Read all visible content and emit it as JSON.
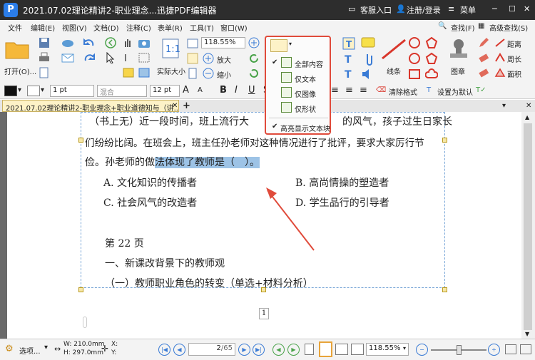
{
  "app": {
    "logo": "P",
    "title": "2021.07.02理论精讲2-职业理念...迅捷PDF编辑器",
    "service": "客服入口",
    "login": "注册/登录",
    "menu": "菜单"
  },
  "menu": {
    "file": "文件",
    "edit": "编辑(E)",
    "view": "视图(V)",
    "doc": "文档(D)",
    "comment": "注释(C)",
    "form": "表单(R)",
    "tools": "工具(T)",
    "window": "窗口(W)",
    "find": "查找(F)",
    "advfind": "高级查找(S)"
  },
  "toolbar": {
    "open": "打开(O)...",
    "actual": "实际大小",
    "zoom": "118.55%",
    "zoomin": "放大",
    "zoomout": "缩小",
    "line": "线条",
    "stamp": "图章",
    "distance": "距离",
    "perimeter": "周长",
    "area": "面积"
  },
  "fmt": {
    "fill": "混合",
    "linewidth": "1 pt",
    "fontsize": "12 pt",
    "clear": "清除格式",
    "setdefault": "设置为默认"
  },
  "tab": {
    "title": "2021.07.02理论精讲2-职业理念+职业道德知与（讲..."
  },
  "dropdown": {
    "items": [
      {
        "label": "全部内容",
        "checked": true
      },
      {
        "label": "仅文本",
        "checked": false
      },
      {
        "label": "仅图像",
        "checked": false
      },
      {
        "label": "仅形状",
        "checked": false
      }
    ],
    "highlight": {
      "label": "高亮显示文本块",
      "checked": true
    }
  },
  "doc": {
    "line1_left": "（书上无）近一段时间，班上流行大",
    "line1_right": "的风气，孩子过生日家长",
    "line2": "们纷纷比阔。在班会上，班主任孙老师对这种情况进行了批评，要求大家厉行节",
    "line3_pre": "俭。孙老师的做",
    "line3_sel": "法体现了教师是（　）。",
    "opt_a": "A. 文化知识的传播者",
    "opt_b": "B. 高尚情操的塑造者",
    "opt_c": "C. 社会风气的改造者",
    "opt_d": "D. 学生品行的引导者",
    "page_heading": "第 22 页",
    "section1": "一、新课改背景下的教师观",
    "section2": "（一）教师职业角色的转变（单选+材料分析）",
    "page_num": "1"
  },
  "status": {
    "options": "选项...",
    "width": "W: 210.0mm",
    "height": "H: 297.0mm",
    "x": "X:",
    "y": "Y:",
    "page": "2",
    "total": "/65",
    "zoom": "118.55%"
  },
  "colors": {
    "accent": "#e04b3b",
    "selection": "#9dc3e6",
    "brand": "#2b7de9"
  }
}
